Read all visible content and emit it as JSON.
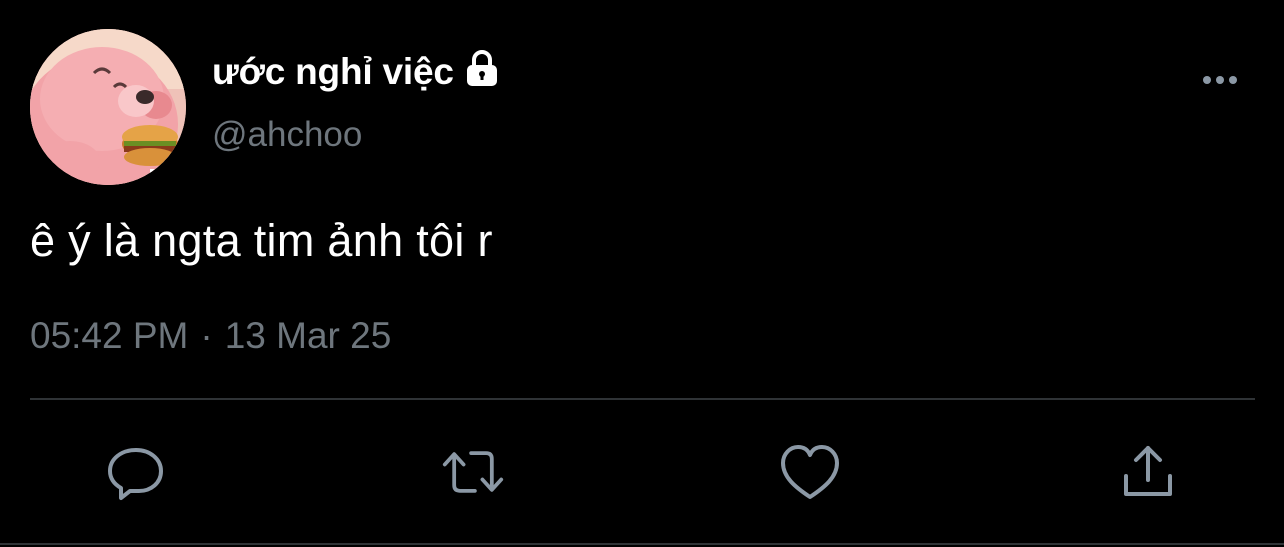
{
  "tweet": {
    "display_name": "ước nghỉ việc",
    "handle": "@ahchoo",
    "text": "ê ý là ngta tim ảnh tôi r",
    "time": "05:42 PM",
    "separator": "·",
    "date": "13 Mar 25"
  },
  "icons": {
    "protected": "lock-icon",
    "more": "more-horizontal-icon",
    "reply": "reply-icon",
    "retweet": "retweet-icon",
    "like": "heart-icon",
    "share": "share-icon"
  },
  "colors": {
    "background": "#000000",
    "primary_text": "#ffffff",
    "secondary_text": "#6e767d",
    "divider": "#2f3336",
    "icon": "#8b98a5"
  }
}
